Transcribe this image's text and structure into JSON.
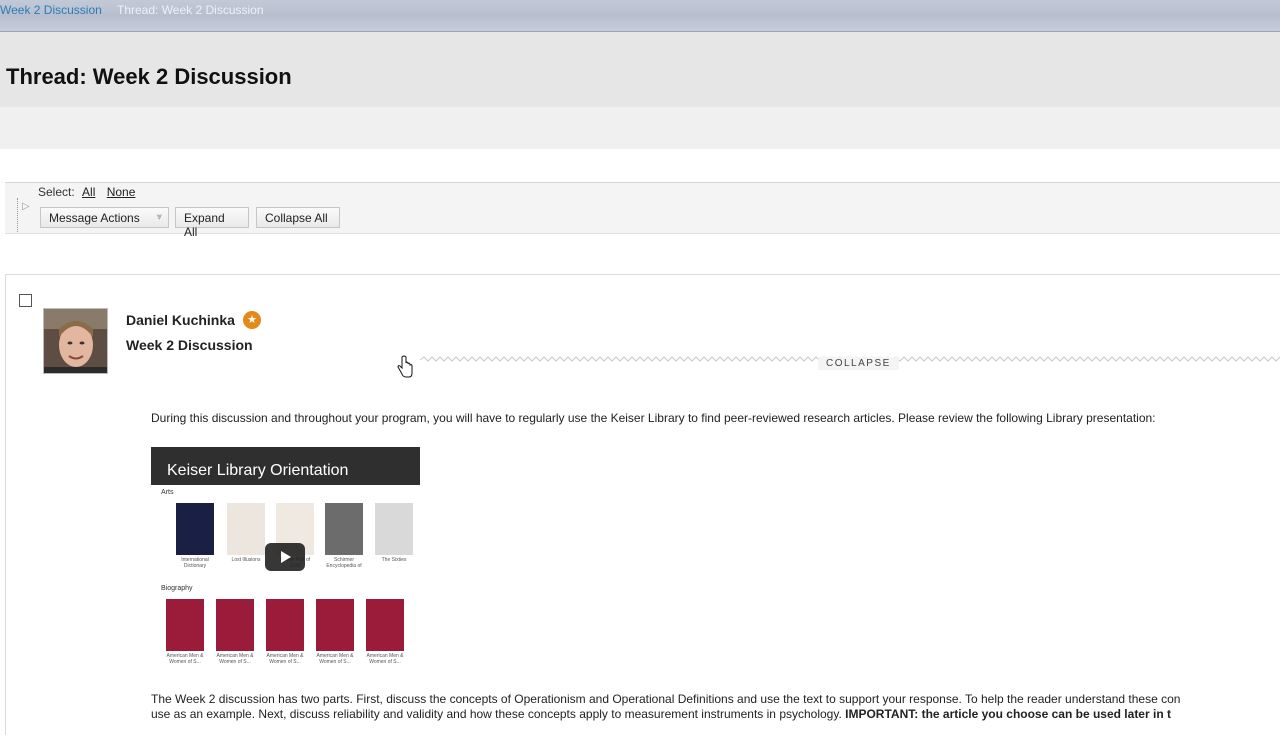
{
  "breadcrumb": {
    "parent": "Week 2 Discussion",
    "current": "Thread: Week 2 Discussion"
  },
  "page": {
    "title": "Thread: Week 2 Discussion"
  },
  "toolbar": {
    "select_label": "Select:",
    "select_all": "All",
    "select_none": "None",
    "message_actions": "Message Actions",
    "expand_all": "Expand All",
    "collapse_all": "Collapse All"
  },
  "post": {
    "author": "Daniel Kuchinka",
    "subject": "Week 2 Discussion",
    "collapse_label": "COLLAPSE",
    "paragraph1": "During this discussion and throughout your program, you will have to regularly use the Keiser Library to find peer-reviewed research articles.  Please review the following Library presentation:",
    "paragraph2": "The Week 2 discussion has two parts.  First, discuss the concepts of Operationism and Operational Definitions and use the text to support your response.  To help the reader understand these con",
    "paragraph2_line2": "use as an example.  Next, discuss reliability and validity and how these concepts apply to measurement instruments in psychology.",
    "paragraph2_bold": "IMPORTANT: the article you choose can be used later in t",
    "video": {
      "title": "Keiser Library Orientation",
      "section1": "Arts",
      "section2": "Biography",
      "books_row1": [
        "International Dictionary",
        "Lost Illusions",
        "A New Pair of Gold",
        "Schirmer Encyclopedia of",
        "The Sixties"
      ],
      "books_row2": [
        "American Men & Women of S...",
        "American Men & Women of S...",
        "American Men & Women of S...",
        "American Men & Women of S...",
        "American Men & Women of S..."
      ]
    }
  },
  "icons": {
    "badge": "star-badge-icon",
    "video_play": "play-icon",
    "dropdown": "chevron-down-icon"
  },
  "colors": {
    "link": "#2a7cb8",
    "badge": "#e48a1b",
    "book_red": "#9b1b3a"
  }
}
